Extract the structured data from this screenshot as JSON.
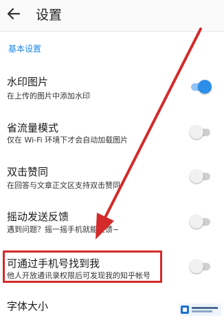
{
  "header": {
    "title": "设置",
    "back_icon": "arrow-left-icon"
  },
  "section": {
    "header": "基本设置"
  },
  "settings": [
    {
      "title": "水印图片",
      "subtitle": "在上传的图片中添加水印",
      "enabled": true
    },
    {
      "title": "省流量模式",
      "subtitle": "仅在 Wi-Fi 环境下才会自动加载图片",
      "enabled": false
    },
    {
      "title": "双击赞同",
      "subtitle": "在回答与文章正文区支持双击赞同",
      "enabled": false
    },
    {
      "title": "摇动发送反馈",
      "subtitle": "遇到问题？摇一摇手机就能反馈~",
      "enabled": false
    },
    {
      "title": "可通过手机号找到我",
      "subtitle": "他人开放通讯录权限后可发现我的知乎帐号",
      "enabled": false
    }
  ],
  "last_item": {
    "title": "字体大小"
  },
  "colors": {
    "accent": "#1e88e5",
    "annotation": "#d42a2a"
  }
}
